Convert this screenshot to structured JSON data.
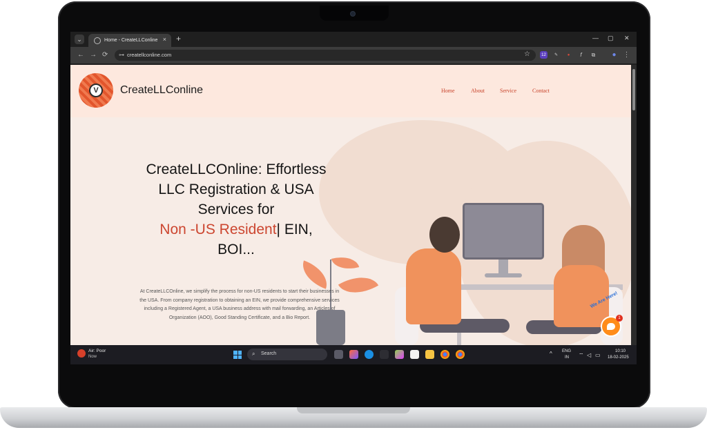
{
  "browser": {
    "tab_title": "Home - CreateLLConline",
    "tab_close": "×",
    "new_tab": "+",
    "url": "createllconline.com",
    "window_controls": {
      "minimize": "—",
      "maximize": "▢",
      "close": "✕"
    },
    "nav": {
      "back": "←",
      "forward": "→",
      "reload": "⟳"
    },
    "extensions": [
      {
        "icon": "extension-badge-icon",
        "text": "12",
        "color": "#5b3fbf"
      },
      {
        "icon": "eyedropper-icon",
        "text": "✎",
        "color": "#3c3c3c"
      },
      {
        "icon": "red-extension-icon",
        "text": "●",
        "color": "#c0392b"
      },
      {
        "icon": "function-icon",
        "text": "f",
        "color": "#3c3c3c"
      },
      {
        "icon": "puzzle-icon",
        "text": "⧉",
        "color": "#3c3c3c"
      },
      {
        "icon": "profile-icon",
        "text": "●",
        "color": "#4a63c9"
      },
      {
        "icon": "menu-icon",
        "text": "⋮",
        "color": "#3c3c3c"
      }
    ]
  },
  "site": {
    "brand": "CreateLLConline",
    "logo_letter": "V",
    "nav": [
      "Home",
      "About",
      "Service",
      "Contact"
    ],
    "hero": {
      "title_line1": "CreateLLCOnline: Effortless",
      "title_line2": "LLC Registration & USA",
      "title_line3": "Services for",
      "title_accent": "Non -US Resident",
      "title_after_accent": "| EIN,",
      "title_line5": "BOI..."
    },
    "description": "At CreateLLCOnline, we simplify the process for non-US residents to start their businesses in the USA. From company registration to obtaining an EIN, we provide comprehensive services including a Registered Agent, a USA business address with mail forwarding, an Articles of Organization (AOO), Good Standing Certificate, and a Bio Report.",
    "chat_widget": {
      "label": "We Are Here!",
      "badge": "1"
    }
  },
  "taskbar": {
    "weather_title": "Air: Poor",
    "weather_sub": "Now",
    "search_placeholder": "Search",
    "language": "ENG",
    "region": "IN",
    "time": "10:10",
    "date": "18-02-2025",
    "tray_chevron": "^",
    "tray_icons": [
      "wifi-icon",
      "volume-icon",
      "battery-icon"
    ]
  }
}
